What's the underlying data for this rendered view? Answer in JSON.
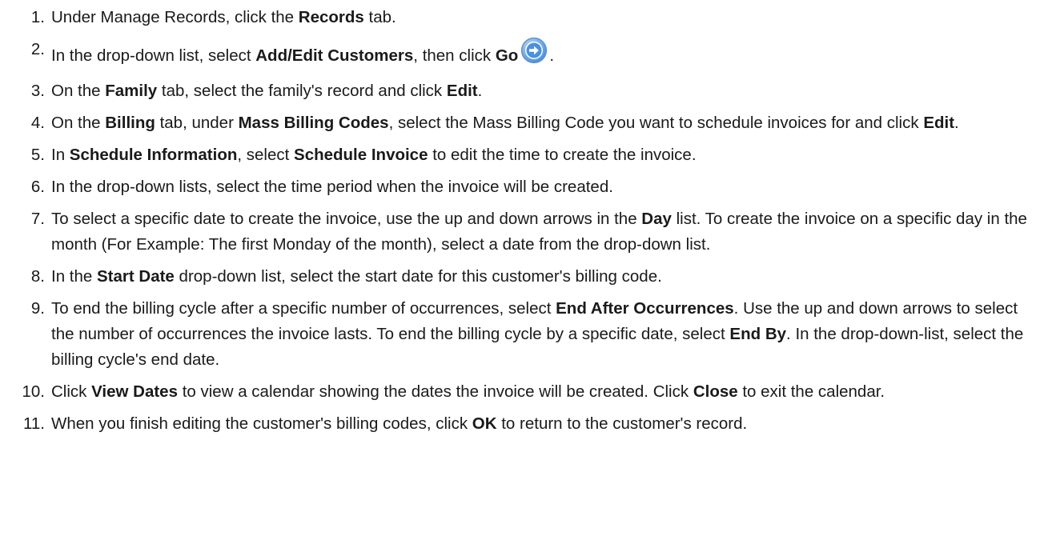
{
  "steps": [
    {
      "num": "1.",
      "segments": [
        {
          "t": "Under Manage Records, click the "
        },
        {
          "t": "Records",
          "b": true
        },
        {
          "t": " tab."
        }
      ]
    },
    {
      "num": "2.",
      "segments": [
        {
          "t": "In the drop-down list, select "
        },
        {
          "t": "Add/Edit Customers",
          "b": true
        },
        {
          "t": ", then click "
        },
        {
          "t": "Go",
          "b": true
        },
        {
          "icon": "go-arrow-icon"
        },
        {
          "t": "."
        }
      ]
    },
    {
      "num": "3.",
      "segments": [
        {
          "t": "On the "
        },
        {
          "t": "Family",
          "b": true
        },
        {
          "t": " tab, select the family's record and click "
        },
        {
          "t": "Edit",
          "b": true
        },
        {
          "t": "."
        }
      ]
    },
    {
      "num": "4.",
      "segments": [
        {
          "t": "On the "
        },
        {
          "t": "Billing",
          "b": true
        },
        {
          "t": " tab, under "
        },
        {
          "t": "Mass Billing Codes",
          "b": true
        },
        {
          "t": ", select the Mass Billing Code you want to schedule invoices for and click "
        },
        {
          "t": "Edit",
          "b": true
        },
        {
          "t": "."
        }
      ]
    },
    {
      "num": "5.",
      "segments": [
        {
          "t": "In "
        },
        {
          "t": "Schedule Information",
          "b": true
        },
        {
          "t": ", select "
        },
        {
          "t": "Schedule Invoice",
          "b": true
        },
        {
          "t": " to edit the time to create the invoice."
        }
      ]
    },
    {
      "num": "6.",
      "segments": [
        {
          "t": "In the drop-down lists, select the time period when the invoice will be created."
        }
      ]
    },
    {
      "num": "7.",
      "segments": [
        {
          "t": "To select a specific date to create the invoice, use the up and down arrows in the "
        },
        {
          "t": "Day",
          "b": true
        },
        {
          "t": " list. To create the invoice on a specific day in the month (For Example: The first Monday of the month), select a date from the drop-down list."
        }
      ]
    },
    {
      "num": "8.",
      "segments": [
        {
          "t": "In the "
        },
        {
          "t": "Start Date",
          "b": true
        },
        {
          "t": " drop-down list, select the start date for this customer's billing code."
        }
      ]
    },
    {
      "num": "9.",
      "segments": [
        {
          "t": "To end the billing cycle after a specific number of occurrences, select "
        },
        {
          "t": "End After Occurrences",
          "b": true
        },
        {
          "t": ". Use the up and down arrows to select the number of occurrences the invoice lasts. To end the billing cycle by a specific date, select "
        },
        {
          "t": "End By",
          "b": true
        },
        {
          "t": ". In the drop-down-list, select the billing cycle's end date."
        }
      ]
    },
    {
      "num": "10.",
      "segments": [
        {
          "t": "Click "
        },
        {
          "t": "View Dates",
          "b": true
        },
        {
          "t": " to view a calendar showing the dates the invoice will be created. Click "
        },
        {
          "t": "Close",
          "b": true
        },
        {
          "t": " to exit the calendar."
        }
      ]
    },
    {
      "num": "11.",
      "segments": [
        {
          "t": "When you finish editing the customer's billing codes, click "
        },
        {
          "t": "OK",
          "b": true
        },
        {
          "t": " to return to the customer's record."
        }
      ]
    }
  ],
  "colors": {
    "text": "#1a1a1a",
    "go_icon_fill": "#4a90e2",
    "go_icon_ring": "#7fb3ec"
  }
}
